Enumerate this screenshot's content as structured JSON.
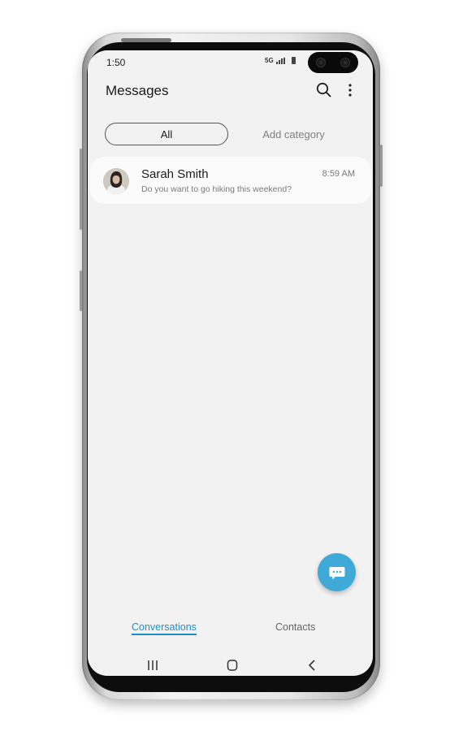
{
  "status_bar": {
    "time": "1:50",
    "network": "5G"
  },
  "header": {
    "title": "Messages",
    "search_icon": "search-icon",
    "more_icon": "more-vertical-icon"
  },
  "categories": {
    "all_label": "All",
    "add_label": "Add category"
  },
  "conversations": [
    {
      "name": "Sarah Smith",
      "time": "8:59 AM",
      "preview": "Do you want to go hiking this weekend?"
    }
  ],
  "fab": {
    "icon": "chat-bubble-icon"
  },
  "bottom_tabs": {
    "conversations_label": "Conversations",
    "contacts_label": "Contacts"
  },
  "navigation": {
    "recents_icon": "recents-icon",
    "home_icon": "home-icon",
    "back_icon": "back-icon"
  },
  "colors": {
    "accent": "#1f8fc8",
    "fab": "#3fa9d8",
    "screen_background": "#f2f2f2"
  }
}
